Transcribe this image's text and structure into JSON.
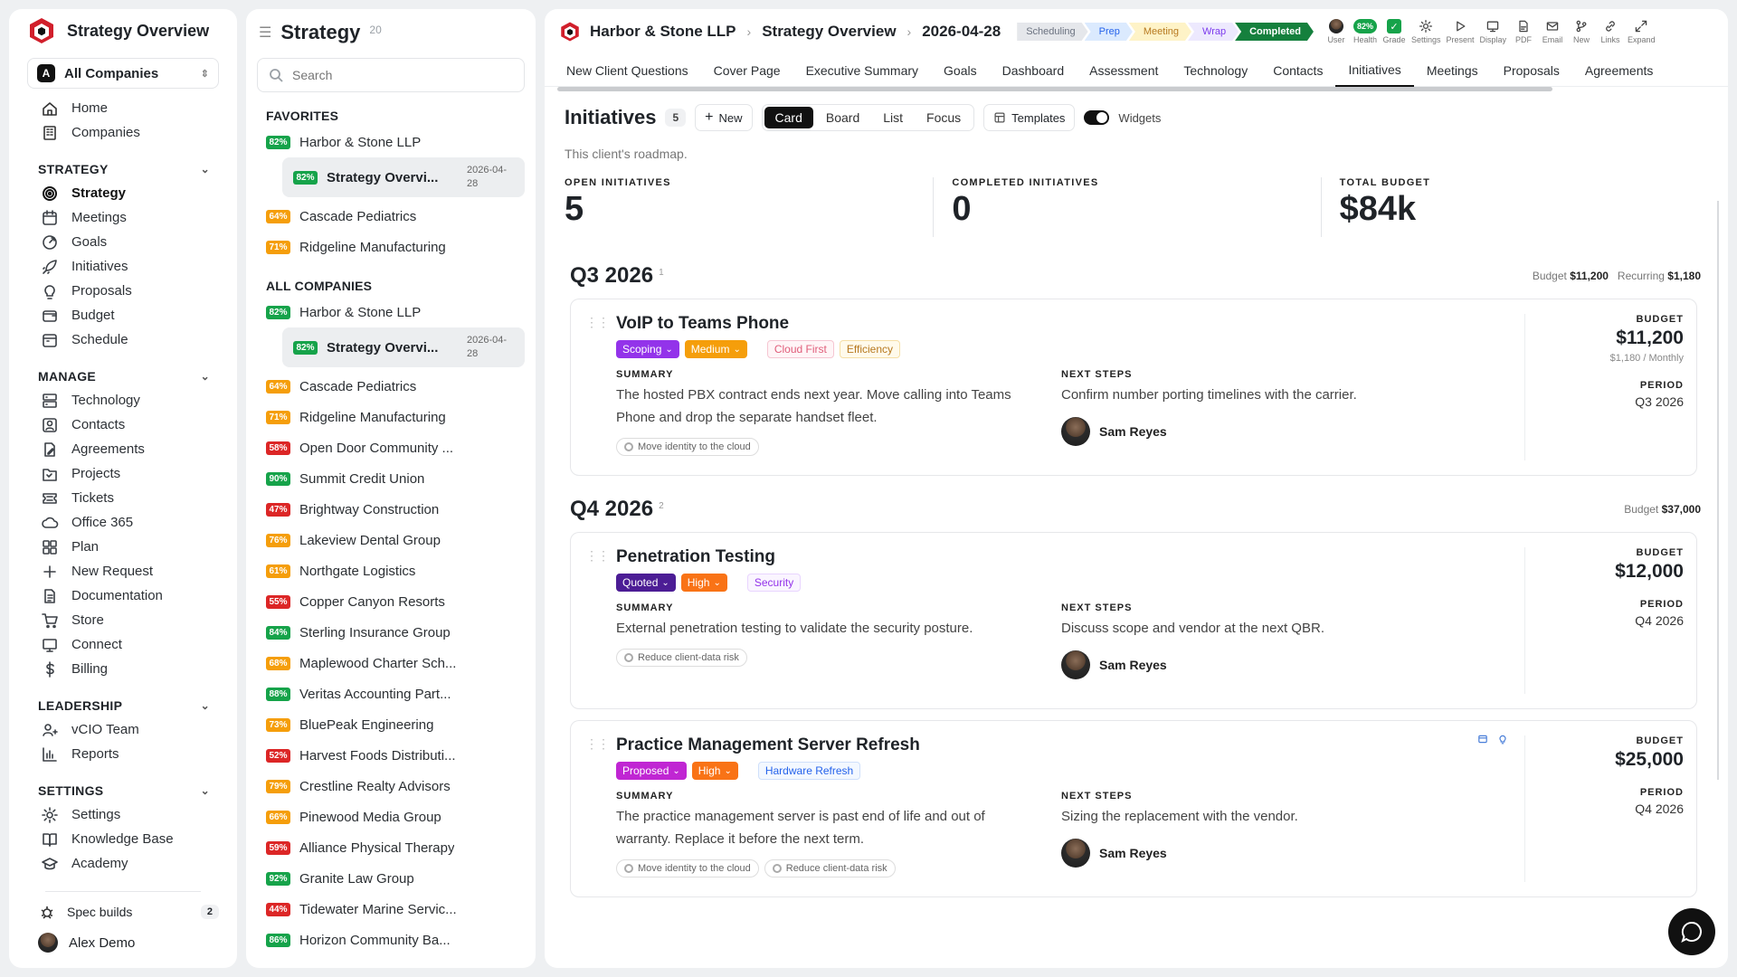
{
  "sidebar": {
    "app_title": "Strategy Overview",
    "company_selector": {
      "badge": "A",
      "value": "All Companies"
    },
    "top_items": [
      {
        "label": "Home",
        "icon": "home-icon"
      },
      {
        "label": "Companies",
        "icon": "building-icon"
      }
    ],
    "sections": [
      {
        "title": "STRATEGY",
        "items": [
          {
            "label": "Strategy",
            "icon": "target-icon",
            "active": true
          },
          {
            "label": "Meetings",
            "icon": "calendar-icon"
          },
          {
            "label": "Goals",
            "icon": "goal-icon"
          },
          {
            "label": "Initiatives",
            "icon": "rocket-icon"
          },
          {
            "label": "Proposals",
            "icon": "lightbulb-icon"
          },
          {
            "label": "Budget",
            "icon": "budget-icon"
          },
          {
            "label": "Schedule",
            "icon": "schedule-icon"
          }
        ]
      },
      {
        "title": "MANAGE",
        "items": [
          {
            "label": "Technology",
            "icon": "server-icon"
          },
          {
            "label": "Contacts",
            "icon": "contact-icon"
          },
          {
            "label": "Agreements",
            "icon": "agreement-icon"
          },
          {
            "label": "Projects",
            "icon": "folder-icon"
          },
          {
            "label": "Tickets",
            "icon": "ticket-icon"
          },
          {
            "label": "Office 365",
            "icon": "cloud-icon"
          },
          {
            "label": "Plan",
            "icon": "grid-icon"
          },
          {
            "label": "New Request",
            "icon": "plus-icon"
          },
          {
            "label": "Documentation",
            "icon": "document-icon"
          },
          {
            "label": "Store",
            "icon": "cart-icon"
          },
          {
            "label": "Connect",
            "icon": "monitor-icon"
          },
          {
            "label": "Billing",
            "icon": "dollar-icon"
          }
        ]
      },
      {
        "title": "LEADERSHIP",
        "items": [
          {
            "label": "vCIO Team",
            "icon": "team-icon"
          },
          {
            "label": "Reports",
            "icon": "chart-icon"
          }
        ]
      },
      {
        "title": "SETTINGS",
        "items": [
          {
            "label": "Settings",
            "icon": "gear-icon"
          },
          {
            "label": "Knowledge Base",
            "icon": "book-icon"
          },
          {
            "label": "Academy",
            "icon": "graduation-icon"
          }
        ]
      }
    ],
    "footer": {
      "spec_builds_label": "Spec builds",
      "spec_builds_count": "2",
      "user_name": "Alex Demo"
    }
  },
  "list_panel": {
    "title": "Strategy",
    "count": "20",
    "search_placeholder": "Search",
    "favorites_title": "FAVORITES",
    "favorites": [
      {
        "pct": "82%",
        "color": "g",
        "name": "Harbor & Stone LLP",
        "sub": {
          "pct": "82%",
          "name": "Strategy Overvi...",
          "date": "2026-04-28"
        }
      },
      {
        "pct": "64%",
        "color": "o",
        "name": "Cascade Pediatrics"
      },
      {
        "pct": "71%",
        "color": "o",
        "name": "Ridgeline Manufacturing"
      }
    ],
    "all_title": "ALL COMPANIES",
    "all": [
      {
        "pct": "82%",
        "color": "g",
        "name": "Harbor & Stone LLP",
        "sub": {
          "pct": "82%",
          "name": "Strategy Overvi...",
          "date": "2026-04-28"
        }
      },
      {
        "pct": "64%",
        "color": "o",
        "name": "Cascade Pediatrics"
      },
      {
        "pct": "71%",
        "color": "o",
        "name": "Ridgeline Manufacturing"
      },
      {
        "pct": "58%",
        "color": "r",
        "name": "Open Door Community ..."
      },
      {
        "pct": "90%",
        "color": "g",
        "name": "Summit Credit Union"
      },
      {
        "pct": "47%",
        "color": "r",
        "name": "Brightway Construction"
      },
      {
        "pct": "76%",
        "color": "o",
        "name": "Lakeview Dental Group"
      },
      {
        "pct": "61%",
        "color": "o",
        "name": "Northgate Logistics"
      },
      {
        "pct": "55%",
        "color": "r",
        "name": "Copper Canyon Resorts"
      },
      {
        "pct": "84%",
        "color": "g",
        "name": "Sterling Insurance Group"
      },
      {
        "pct": "68%",
        "color": "o",
        "name": "Maplewood Charter Sch..."
      },
      {
        "pct": "88%",
        "color": "g",
        "name": "Veritas Accounting Part..."
      },
      {
        "pct": "73%",
        "color": "o",
        "name": "BluePeak Engineering"
      },
      {
        "pct": "52%",
        "color": "r",
        "name": "Harvest Foods Distributi..."
      },
      {
        "pct": "79%",
        "color": "o",
        "name": "Crestline Realty Advisors"
      },
      {
        "pct": "66%",
        "color": "o",
        "name": "Pinewood Media Group"
      },
      {
        "pct": "59%",
        "color": "r",
        "name": "Alliance Physical Therapy"
      },
      {
        "pct": "92%",
        "color": "g",
        "name": "Granite Law Group"
      },
      {
        "pct": "44%",
        "color": "r",
        "name": "Tidewater Marine Servic..."
      },
      {
        "pct": "86%",
        "color": "g",
        "name": "Horizon Community Ba..."
      }
    ]
  },
  "topbar": {
    "company": "Harbor & Stone LLP",
    "page": "Strategy Overview",
    "date": "2026-04-28",
    "stages": [
      {
        "label": "Scheduling",
        "bg": "#e5e7eb",
        "fg": "#6b7280"
      },
      {
        "label": "Prep",
        "bg": "#dbeafe",
        "fg": "#2563eb"
      },
      {
        "label": "Meeting",
        "bg": "#fef3c7",
        "fg": "#b7791f"
      },
      {
        "label": "Wrap",
        "bg": "#ede9fe",
        "fg": "#7c3aed"
      },
      {
        "label": "Completed",
        "bg": "#15803d",
        "fg": "#ffffff"
      }
    ],
    "tools": [
      {
        "label": "User",
        "kind": "avatar"
      },
      {
        "label": "Health",
        "kind": "health",
        "value": "82%"
      },
      {
        "label": "Grade",
        "kind": "grade"
      },
      {
        "label": "Settings",
        "kind": "icon",
        "icon": "gear-icon"
      },
      {
        "label": "Present",
        "kind": "icon",
        "icon": "play-icon"
      },
      {
        "label": "Display",
        "kind": "icon",
        "icon": "monitor-icon"
      },
      {
        "label": "PDF",
        "kind": "icon",
        "icon": "pdf-icon"
      },
      {
        "label": "Email",
        "kind": "icon",
        "icon": "mail-icon"
      },
      {
        "label": "New",
        "kind": "icon",
        "icon": "branch-icon"
      },
      {
        "label": "Links",
        "kind": "icon",
        "icon": "link-icon"
      },
      {
        "label": "Expand",
        "kind": "icon",
        "icon": "expand-icon"
      }
    ]
  },
  "tabs": [
    "New Client Questions",
    "Cover Page",
    "Executive Summary",
    "Goals",
    "Dashboard",
    "Assessment",
    "Technology",
    "Contacts",
    "Initiatives",
    "Meetings",
    "Proposals",
    "Agreements"
  ],
  "active_tab": "Initiatives",
  "initiatives": {
    "title": "Initiatives",
    "count": "5",
    "new_label": "New",
    "views": [
      "Card",
      "Board",
      "List",
      "Focus"
    ],
    "active_view": "Card",
    "templates_label": "Templates",
    "widgets_label": "Widgets",
    "description": "This client's roadmap.",
    "metrics": [
      {
        "label": "OPEN INITIATIVES",
        "value": "5"
      },
      {
        "label": "COMPLETED INITIATIVES",
        "value": "0"
      },
      {
        "label": "TOTAL BUDGET",
        "value": "$84k"
      }
    ],
    "quarters": [
      {
        "title": "Q3 2026",
        "count": "1",
        "budget_label": "Budget",
        "budget": "$11,200",
        "recurring_label": "Recurring",
        "recurring": "$1,180",
        "cards": [
          {
            "title": "VoIP to Teams Phone",
            "status": {
              "label": "Scoping",
              "color": "#9333ea"
            },
            "priority": {
              "label": "Medium",
              "color": "#f59e0b"
            },
            "chips": [
              {
                "label": "Cloud First",
                "fg": "#e05d7a",
                "bd": "#f6c6d2",
                "bg": "#fff5f7"
              },
              {
                "label": "Efficiency",
                "fg": "#b7791f",
                "bd": "#f6dfa5",
                "bg": "#fffaeb"
              }
            ],
            "summary_label": "SUMMARY",
            "summary": "The hosted PBX contract ends next year. Move calling into Teams Phone and drop the separate handset fleet.",
            "goals": [
              "Move identity to the cloud"
            ],
            "next_label": "NEXT STEPS",
            "next": "Confirm number porting timelines with the carrier.",
            "owner": "Sam Reyes",
            "budget_label": "BUDGET",
            "budget": "$11,200",
            "monthly": "$1,180 / Monthly",
            "period_label": "PERIOD",
            "period": "Q3 2026",
            "icons": false
          }
        ]
      },
      {
        "title": "Q4 2026",
        "count": "2",
        "budget_label": "Budget",
        "budget": "$37,000",
        "cards": [
          {
            "title": "Penetration Testing",
            "status": {
              "label": "Quoted",
              "color": "#4c1d95"
            },
            "priority": {
              "label": "High",
              "color": "#f97316"
            },
            "chips": [
              {
                "label": "Security",
                "fg": "#9333ea",
                "bd": "#e9d5ff",
                "bg": "#faf5ff"
              }
            ],
            "summary_label": "SUMMARY",
            "summary": "External penetration testing to validate the security posture.",
            "goals": [
              "Reduce client-data risk"
            ],
            "next_label": "NEXT STEPS",
            "next": "Discuss scope and vendor at the next QBR.",
            "owner": "Sam Reyes",
            "budget_label": "BUDGET",
            "budget": "$12,000",
            "period_label": "PERIOD",
            "period": "Q4 2026",
            "icons": false
          },
          {
            "title": "Practice Management Server Refresh",
            "status": {
              "label": "Proposed",
              "color": "#c026d3"
            },
            "priority": {
              "label": "High",
              "color": "#f97316"
            },
            "chips": [
              {
                "label": "Hardware Refresh",
                "fg": "#2563eb",
                "bd": "#cfe0fb",
                "bg": "#f3f8ff"
              }
            ],
            "summary_label": "SUMMARY",
            "summary": "The practice management server is past end of life and out of warranty. Replace it before the next term.",
            "goals": [
              "Move identity to the cloud",
              "Reduce client-data risk"
            ],
            "next_label": "NEXT STEPS",
            "next": "Sizing the replacement with the vendor.",
            "owner": "Sam Reyes",
            "budget_label": "BUDGET",
            "budget": "$25,000",
            "period_label": "PERIOD",
            "period": "Q4 2026",
            "icons": true
          }
        ]
      }
    ]
  }
}
